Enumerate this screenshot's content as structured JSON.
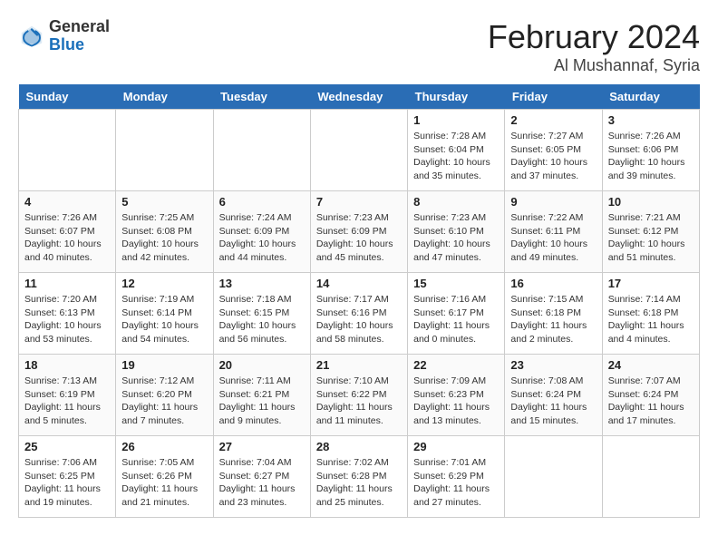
{
  "header": {
    "logo_general": "General",
    "logo_blue": "Blue",
    "month": "February 2024",
    "location": "Al Mushannaf, Syria"
  },
  "days_of_week": [
    "Sunday",
    "Monday",
    "Tuesday",
    "Wednesday",
    "Thursday",
    "Friday",
    "Saturday"
  ],
  "weeks": [
    [
      {
        "day": "",
        "sunrise": "",
        "sunset": "",
        "daylight": ""
      },
      {
        "day": "",
        "sunrise": "",
        "sunset": "",
        "daylight": ""
      },
      {
        "day": "",
        "sunrise": "",
        "sunset": "",
        "daylight": ""
      },
      {
        "day": "",
        "sunrise": "",
        "sunset": "",
        "daylight": ""
      },
      {
        "day": "1",
        "sunrise": "Sunrise: 7:28 AM",
        "sunset": "Sunset: 6:04 PM",
        "daylight": "Daylight: 10 hours and 35 minutes."
      },
      {
        "day": "2",
        "sunrise": "Sunrise: 7:27 AM",
        "sunset": "Sunset: 6:05 PM",
        "daylight": "Daylight: 10 hours and 37 minutes."
      },
      {
        "day": "3",
        "sunrise": "Sunrise: 7:26 AM",
        "sunset": "Sunset: 6:06 PM",
        "daylight": "Daylight: 10 hours and 39 minutes."
      }
    ],
    [
      {
        "day": "4",
        "sunrise": "Sunrise: 7:26 AM",
        "sunset": "Sunset: 6:07 PM",
        "daylight": "Daylight: 10 hours and 40 minutes."
      },
      {
        "day": "5",
        "sunrise": "Sunrise: 7:25 AM",
        "sunset": "Sunset: 6:08 PM",
        "daylight": "Daylight: 10 hours and 42 minutes."
      },
      {
        "day": "6",
        "sunrise": "Sunrise: 7:24 AM",
        "sunset": "Sunset: 6:09 PM",
        "daylight": "Daylight: 10 hours and 44 minutes."
      },
      {
        "day": "7",
        "sunrise": "Sunrise: 7:23 AM",
        "sunset": "Sunset: 6:09 PM",
        "daylight": "Daylight: 10 hours and 45 minutes."
      },
      {
        "day": "8",
        "sunrise": "Sunrise: 7:23 AM",
        "sunset": "Sunset: 6:10 PM",
        "daylight": "Daylight: 10 hours and 47 minutes."
      },
      {
        "day": "9",
        "sunrise": "Sunrise: 7:22 AM",
        "sunset": "Sunset: 6:11 PM",
        "daylight": "Daylight: 10 hours and 49 minutes."
      },
      {
        "day": "10",
        "sunrise": "Sunrise: 7:21 AM",
        "sunset": "Sunset: 6:12 PM",
        "daylight": "Daylight: 10 hours and 51 minutes."
      }
    ],
    [
      {
        "day": "11",
        "sunrise": "Sunrise: 7:20 AM",
        "sunset": "Sunset: 6:13 PM",
        "daylight": "Daylight: 10 hours and 53 minutes."
      },
      {
        "day": "12",
        "sunrise": "Sunrise: 7:19 AM",
        "sunset": "Sunset: 6:14 PM",
        "daylight": "Daylight: 10 hours and 54 minutes."
      },
      {
        "day": "13",
        "sunrise": "Sunrise: 7:18 AM",
        "sunset": "Sunset: 6:15 PM",
        "daylight": "Daylight: 10 hours and 56 minutes."
      },
      {
        "day": "14",
        "sunrise": "Sunrise: 7:17 AM",
        "sunset": "Sunset: 6:16 PM",
        "daylight": "Daylight: 10 hours and 58 minutes."
      },
      {
        "day": "15",
        "sunrise": "Sunrise: 7:16 AM",
        "sunset": "Sunset: 6:17 PM",
        "daylight": "Daylight: 11 hours and 0 minutes."
      },
      {
        "day": "16",
        "sunrise": "Sunrise: 7:15 AM",
        "sunset": "Sunset: 6:18 PM",
        "daylight": "Daylight: 11 hours and 2 minutes."
      },
      {
        "day": "17",
        "sunrise": "Sunrise: 7:14 AM",
        "sunset": "Sunset: 6:18 PM",
        "daylight": "Daylight: 11 hours and 4 minutes."
      }
    ],
    [
      {
        "day": "18",
        "sunrise": "Sunrise: 7:13 AM",
        "sunset": "Sunset: 6:19 PM",
        "daylight": "Daylight: 11 hours and 5 minutes."
      },
      {
        "day": "19",
        "sunrise": "Sunrise: 7:12 AM",
        "sunset": "Sunset: 6:20 PM",
        "daylight": "Daylight: 11 hours and 7 minutes."
      },
      {
        "day": "20",
        "sunrise": "Sunrise: 7:11 AM",
        "sunset": "Sunset: 6:21 PM",
        "daylight": "Daylight: 11 hours and 9 minutes."
      },
      {
        "day": "21",
        "sunrise": "Sunrise: 7:10 AM",
        "sunset": "Sunset: 6:22 PM",
        "daylight": "Daylight: 11 hours and 11 minutes."
      },
      {
        "day": "22",
        "sunrise": "Sunrise: 7:09 AM",
        "sunset": "Sunset: 6:23 PM",
        "daylight": "Daylight: 11 hours and 13 minutes."
      },
      {
        "day": "23",
        "sunrise": "Sunrise: 7:08 AM",
        "sunset": "Sunset: 6:24 PM",
        "daylight": "Daylight: 11 hours and 15 minutes."
      },
      {
        "day": "24",
        "sunrise": "Sunrise: 7:07 AM",
        "sunset": "Sunset: 6:24 PM",
        "daylight": "Daylight: 11 hours and 17 minutes."
      }
    ],
    [
      {
        "day": "25",
        "sunrise": "Sunrise: 7:06 AM",
        "sunset": "Sunset: 6:25 PM",
        "daylight": "Daylight: 11 hours and 19 minutes."
      },
      {
        "day": "26",
        "sunrise": "Sunrise: 7:05 AM",
        "sunset": "Sunset: 6:26 PM",
        "daylight": "Daylight: 11 hours and 21 minutes."
      },
      {
        "day": "27",
        "sunrise": "Sunrise: 7:04 AM",
        "sunset": "Sunset: 6:27 PM",
        "daylight": "Daylight: 11 hours and 23 minutes."
      },
      {
        "day": "28",
        "sunrise": "Sunrise: 7:02 AM",
        "sunset": "Sunset: 6:28 PM",
        "daylight": "Daylight: 11 hours and 25 minutes."
      },
      {
        "day": "29",
        "sunrise": "Sunrise: 7:01 AM",
        "sunset": "Sunset: 6:29 PM",
        "daylight": "Daylight: 11 hours and 27 minutes."
      },
      {
        "day": "",
        "sunrise": "",
        "sunset": "",
        "daylight": ""
      },
      {
        "day": "",
        "sunrise": "",
        "sunset": "",
        "daylight": ""
      }
    ]
  ]
}
